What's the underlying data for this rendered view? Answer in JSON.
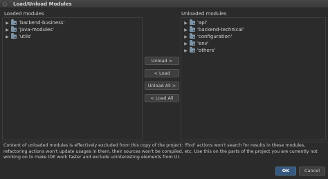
{
  "window": {
    "title": "Load/Unload Modules",
    "close_glyph": "×"
  },
  "loaded": {
    "label": "Loaded modules",
    "items": [
      {
        "label": "'backend-business'",
        "icon": "module-folder-icon"
      },
      {
        "label": "'java-modules'",
        "icon": "module-folder-icon"
      },
      {
        "label": "'utils'",
        "icon": "module-folder-icon"
      }
    ]
  },
  "unloaded": {
    "label": "Unloaded modules",
    "items": [
      {
        "label": "'api'",
        "icon": "module-folder-icon"
      },
      {
        "label": "'backend-technical'",
        "icon": "module-folder-icon"
      },
      {
        "label": "'configuration'",
        "icon": "module-folder-icon"
      },
      {
        "label": "'env'",
        "icon": "module-folder-icon"
      },
      {
        "label": "'others'",
        "icon": "module-folder-icon"
      }
    ]
  },
  "actions": {
    "unload": "Unload >",
    "load": "< Load",
    "unload_all": "Unload All >",
    "load_all": "< Load All"
  },
  "info_text": "Content of unloaded modules is effectively excluded from this copy of the project: 'Find' actions won't search for results in these modules, refactoring actions won't update usages in them, their sources won't be compiled, etc. Use this on the parts of the project you are currently not working on to make IDE work faster and exclude uninteresting elements from UI.",
  "footer": {
    "ok": "OK",
    "cancel": "Cancel"
  },
  "tree_arrow": "▶",
  "colors": {
    "ok_button": "#365880",
    "folder_icon": "#7c94a8",
    "background": "#2b2b2b"
  }
}
